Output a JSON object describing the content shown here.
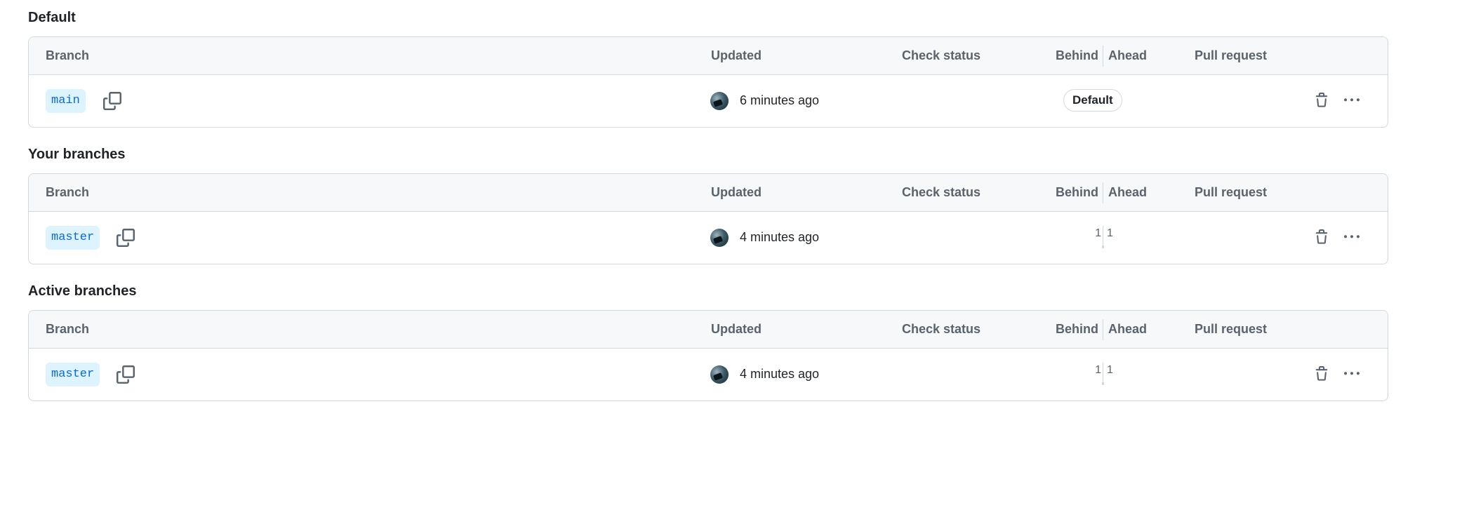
{
  "table_headers": {
    "branch": "Branch",
    "updated": "Updated",
    "check_status": "Check status",
    "behind": "Behind",
    "ahead": "Ahead",
    "pull_request": "Pull request"
  },
  "sections": [
    {
      "title": "Default",
      "rows": [
        {
          "branch": "main",
          "updated": "6 minutes ago",
          "badge": "Default",
          "behind": "",
          "ahead": ""
        }
      ]
    },
    {
      "title": "Your branches",
      "rows": [
        {
          "branch": "master",
          "updated": "4 minutes ago",
          "badge": "",
          "behind": "1",
          "ahead": "1"
        }
      ]
    },
    {
      "title": "Active branches",
      "rows": [
        {
          "branch": "master",
          "updated": "4 minutes ago",
          "badge": "",
          "behind": "1",
          "ahead": "1"
        }
      ]
    }
  ],
  "icons": {
    "copy": "copy-icon",
    "trash": "trash-icon",
    "more": "kebab-horizontal-icon"
  },
  "colors": {
    "branch_bg": "#ddf4ff",
    "branch_text": "#0969da",
    "header_bg": "#f6f8fa",
    "border": "#d1d9e0"
  }
}
